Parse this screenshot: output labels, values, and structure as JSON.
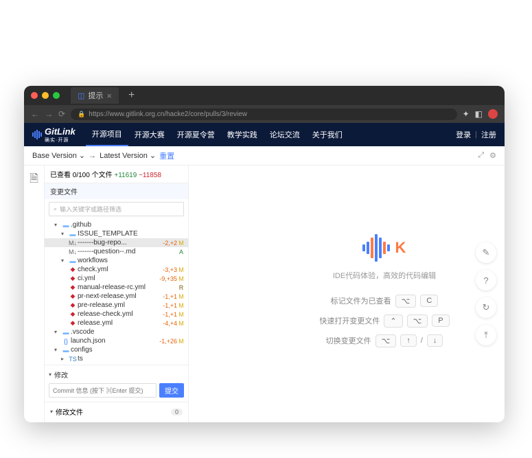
{
  "browser": {
    "tab_title": "提示",
    "url": "https://www.gitlink.org.cn/hacke2/core/pulls/3/review"
  },
  "header": {
    "brand": "GitLink",
    "slogan": "确实·开源",
    "nav": [
      "开源项目",
      "开源大赛",
      "开源夏令营",
      "教学实践",
      "论坛交流",
      "关于我们"
    ],
    "login": "登录",
    "register": "注册"
  },
  "version_bar": {
    "base": "Base Version",
    "latest": "Latest Version",
    "reset": "重置"
  },
  "sidebar": {
    "viewed": "已查看 0/100 个文件",
    "added": "+11619",
    "removed": "−11858",
    "changed_header": "变更文件",
    "search_placeholder": "输入关键字或路径筛选",
    "tree": {
      "github": ".github",
      "issue_template": "ISSUE_TEMPLATE",
      "bug": "-------bug-repo...",
      "bug_diff": "-2,+2",
      "question": "-------question--.md",
      "workflows": "workflows",
      "check": "check.yml",
      "check_diff": "-3,+3",
      "ci": "ci.yml",
      "ci_diff": "-9,+35",
      "manual": "manual-release-rc.yml",
      "prnext": "pr-next-release.yml",
      "prnext_diff": "-1,+1",
      "prerel": "pre-release.yml",
      "prerel_diff": "-1,+1",
      "relcheck": "release-check.yml",
      "relcheck_diff": "-1,+1",
      "release": "release.yml",
      "release_diff": "-4,+4",
      "vscode": ".vscode",
      "launch": "launch.json",
      "launch_diff": "-1,+26",
      "configs": "configs",
      "ts": "ts"
    },
    "commit_header": "修改",
    "commit_placeholder": "Commit 信息 (按下 ⌘Enter 提交)",
    "commit_btn": "提交",
    "mod_header": "修改文件",
    "mod_count": "0"
  },
  "main": {
    "logo_text": "K",
    "tagline": "IDE代码体验，高效的代码编辑",
    "shortcuts": [
      {
        "label": "标记文件为已查看",
        "keys": [
          "⌥",
          "C"
        ]
      },
      {
        "label": "快速打开变更文件",
        "keys": [
          "⌃",
          "⌥",
          "P"
        ]
      },
      {
        "label": "切换变更文件",
        "keys": [
          "⌥",
          "↑",
          "/",
          "↓"
        ]
      }
    ]
  }
}
